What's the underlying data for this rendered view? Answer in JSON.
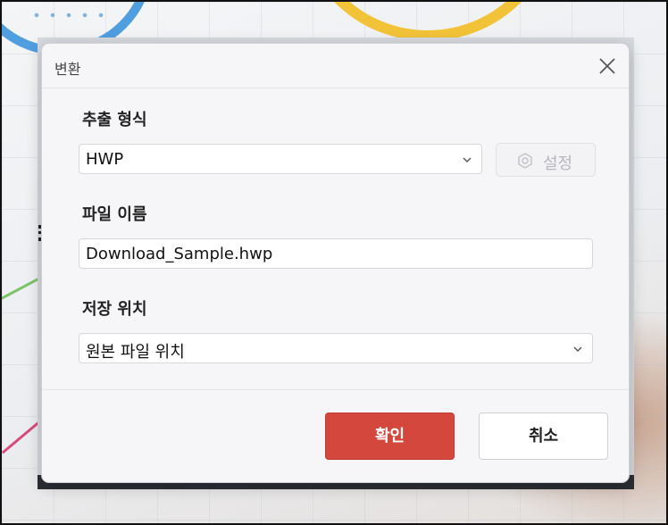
{
  "dialog": {
    "title": "변환",
    "close_icon": "close-icon"
  },
  "format": {
    "label": "추출 형식",
    "selected": "HWP",
    "settings_label": "설정",
    "settings_icon": "gear-icon"
  },
  "filename": {
    "label": "파일 이름",
    "value": "Download_Sample.hwp"
  },
  "location": {
    "label": "저장 위치",
    "selected": "원본 파일 위치"
  },
  "buttons": {
    "ok_label": "확인",
    "cancel_label": "취소"
  },
  "colors": {
    "primary": "#d4473d",
    "background": "#f6f6f8"
  }
}
